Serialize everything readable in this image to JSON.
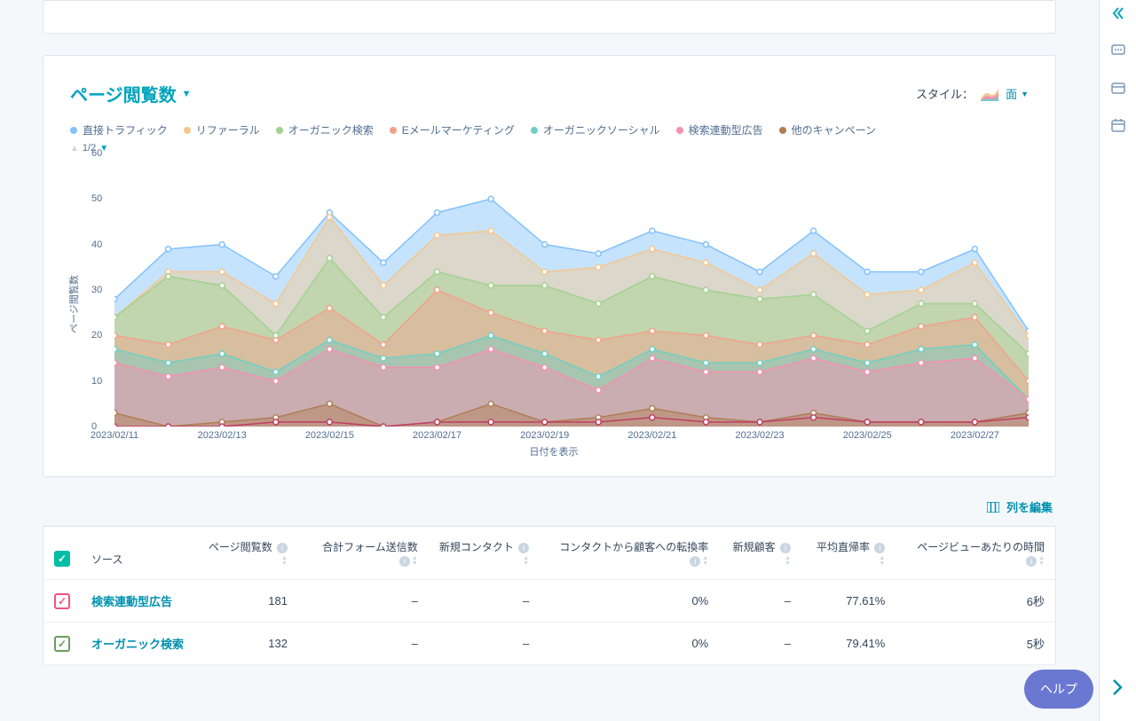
{
  "header": {
    "title": "ページ閲覧数",
    "style_label": "スタイル：",
    "style_value": "面"
  },
  "legend": {
    "items": [
      "直接トラフィック",
      "リファーラル",
      "オーガニック検索",
      "Eメールマーケティング",
      "オーガニックソーシャル",
      "検索連動型広告",
      "他のキャンペーン"
    ],
    "pager": "1/2"
  },
  "axis": {
    "y": "ページ閲覧数",
    "x": "日付を表示"
  },
  "edit_cols": "列を編集",
  "help": "ヘルプ",
  "table": {
    "headers": [
      "",
      "ソース",
      "ページ閲覧数",
      "合計フォーム送信数",
      "新規コンタクト",
      "コンタクトから顧客への転換率",
      "新規顧客",
      "平均直帰率",
      "ページビューあたりの時間"
    ],
    "rows": [
      {
        "cb": "pink",
        "source": "検索連動型広告",
        "pv": "181",
        "f": "–",
        "nc": "–",
        "cr": "0%",
        "cu": "–",
        "br": "77.61%",
        "t": "6秒"
      },
      {
        "cb": "green",
        "source": "オーガニック検索",
        "pv": "132",
        "f": "–",
        "nc": "–",
        "cr": "0%",
        "cu": "–",
        "br": "79.41%",
        "t": "5秒"
      }
    ]
  },
  "chart_data": {
    "type": "area",
    "title": "ページ閲覧数",
    "xlabel": "日付を表示",
    "ylabel": "ページ閲覧数",
    "ylim": [
      0,
      60
    ],
    "categories": [
      "2023/02/11",
      "2023/02/12",
      "2023/02/13",
      "2023/02/14",
      "2023/02/15",
      "2023/02/16",
      "2023/02/17",
      "2023/02/18",
      "2023/02/19",
      "2023/02/20",
      "2023/02/21",
      "2023/02/22",
      "2023/02/23",
      "2023/02/24",
      "2023/02/25",
      "2023/02/26",
      "2023/02/27",
      "2023/02/28"
    ],
    "xticks": [
      "2023/02/11",
      "2023/02/13",
      "2023/02/15",
      "2023/02/17",
      "2023/02/19",
      "2023/02/21",
      "2023/02/23",
      "2023/02/25",
      "2023/02/27"
    ],
    "series": [
      {
        "name": "直接トラフィック",
        "color": "#81c1fd",
        "values": [
          28,
          39,
          40,
          33,
          47,
          36,
          47,
          50,
          40,
          38,
          43,
          40,
          34,
          43,
          34,
          34,
          39,
          21
        ]
      },
      {
        "name": "リファーラル",
        "color": "#f5c78e",
        "values": [
          24,
          34,
          34,
          27,
          46,
          31,
          42,
          43,
          34,
          35,
          39,
          36,
          30,
          38,
          29,
          30,
          36,
          20
        ]
      },
      {
        "name": "オーガニック検索",
        "color": "#a2d28f",
        "values": [
          24,
          33,
          31,
          20,
          37,
          24,
          34,
          31,
          31,
          27,
          33,
          30,
          28,
          29,
          21,
          27,
          27,
          16
        ]
      },
      {
        "name": "Eメールマーケティング",
        "color": "#f2a18a",
        "values": [
          20,
          18,
          22,
          19,
          26,
          18,
          30,
          25,
          21,
          19,
          21,
          20,
          18,
          20,
          18,
          22,
          24,
          10
        ]
      },
      {
        "name": "オーガニックソーシャル",
        "color": "#6fcfc4",
        "values": [
          17,
          14,
          16,
          12,
          19,
          15,
          16,
          20,
          16,
          11,
          17,
          14,
          14,
          17,
          14,
          17,
          18,
          6
        ]
      },
      {
        "name": "検索連動型広告",
        "color": "#f490b1",
        "values": [
          14,
          11,
          13,
          10,
          17,
          13,
          13,
          17,
          13,
          8,
          15,
          12,
          12,
          15,
          12,
          14,
          15,
          6
        ]
      },
      {
        "name": "他のキャンペーン",
        "color": "#b07d56",
        "values": [
          3,
          0,
          1,
          2,
          5,
          0,
          1,
          5,
          1,
          2,
          4,
          2,
          1,
          3,
          1,
          1,
          1,
          3
        ]
      }
    ],
    "extra_line": {
      "color": "#c23d64",
      "values": [
        0,
        0,
        0,
        1,
        1,
        0,
        1,
        1,
        1,
        1,
        2,
        1,
        1,
        2,
        1,
        1,
        1,
        2
      ]
    }
  }
}
